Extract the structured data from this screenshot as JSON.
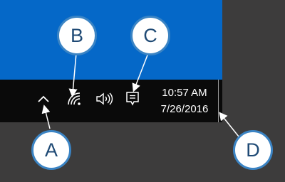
{
  "taskbar": {
    "tray_icons": [
      {
        "name": "show-hidden-icons-chevron-icon"
      },
      {
        "name": "network-wifi-icon"
      },
      {
        "name": "volume-speaker-icon"
      },
      {
        "name": "action-center-notifications-icon"
      }
    ],
    "clock": {
      "time": "10:57 AM",
      "date": "7/26/2016"
    }
  },
  "callouts": {
    "a": "A",
    "b": "B",
    "c": "C",
    "d": "D"
  },
  "colors": {
    "desktop_background": "#0568c8",
    "taskbar": "#0a0a0a",
    "outer_background": "#3d3c3c",
    "callout_border": "#3b84c4",
    "callout_text": "#1f4a75"
  }
}
